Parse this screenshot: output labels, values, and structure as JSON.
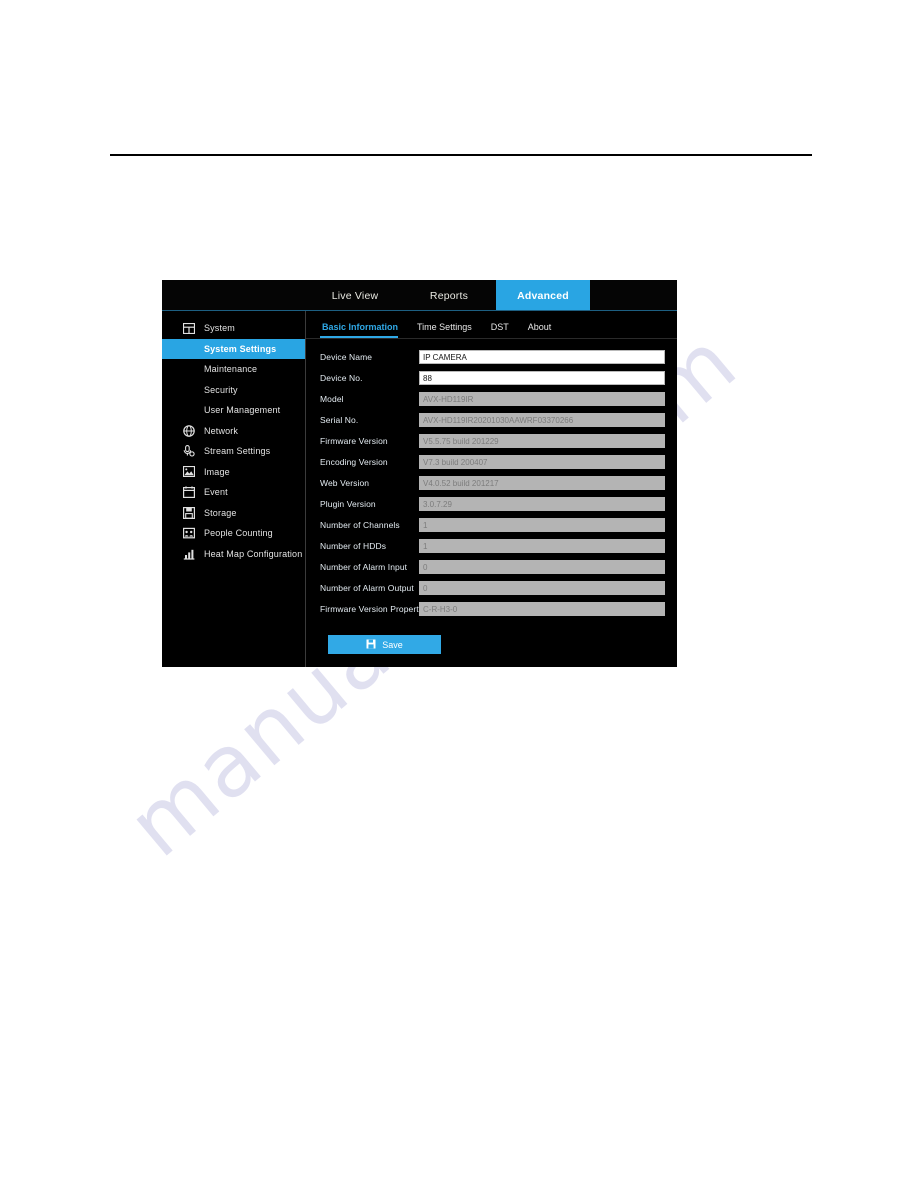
{
  "page": {
    "watermark_text": "manualslive.com",
    "rule": "horizontal-rule"
  },
  "app": {
    "accent_color": "#29a5e3",
    "background_color": "#000000",
    "top_nav": {
      "tabs": [
        {
          "label": "Live View",
          "active": false
        },
        {
          "label": "Reports",
          "active": false
        },
        {
          "label": "Advanced",
          "active": true
        }
      ]
    },
    "sidebar": {
      "items": [
        {
          "label": "System",
          "icon": "system-icon",
          "level": "top",
          "active": false
        },
        {
          "label": "System Settings",
          "icon": "",
          "level": "sub",
          "active": true
        },
        {
          "label": "Maintenance",
          "icon": "",
          "level": "sub",
          "active": false
        },
        {
          "label": "Security",
          "icon": "",
          "level": "sub",
          "active": false
        },
        {
          "label": "User Management",
          "icon": "",
          "level": "sub",
          "active": false
        },
        {
          "label": "Network",
          "icon": "globe-icon",
          "level": "top",
          "active": false
        },
        {
          "label": "Stream Settings",
          "icon": "microphone-icon",
          "level": "top",
          "active": false
        },
        {
          "label": "Image",
          "icon": "picture-icon",
          "level": "top",
          "active": false
        },
        {
          "label": "Event",
          "icon": "calendar-icon",
          "level": "top",
          "active": false
        },
        {
          "label": "Storage",
          "icon": "floppy-disk-icon",
          "level": "top",
          "active": false
        },
        {
          "label": "People Counting",
          "icon": "people-counting-icon",
          "level": "top",
          "active": false
        },
        {
          "label": "Heat Map Configuration",
          "icon": "bar-chart-icon",
          "level": "top",
          "active": false
        }
      ]
    },
    "sub_tabs": [
      {
        "label": "Basic Information",
        "active": true
      },
      {
        "label": "Time Settings",
        "active": false
      },
      {
        "label": "DST",
        "active": false
      },
      {
        "label": "About",
        "active": false
      }
    ],
    "form": {
      "fields": [
        {
          "label": "Device Name",
          "value": "IP CAMERA",
          "readonly": false
        },
        {
          "label": "Device No.",
          "value": "88",
          "readonly": false
        },
        {
          "label": "Model",
          "value": "AVX-HD119IR",
          "readonly": true
        },
        {
          "label": "Serial No.",
          "value": "AVX-HD119IR20201030AAWRF03370266",
          "readonly": true
        },
        {
          "label": "Firmware Version",
          "value": "V5.5.75 build 201229",
          "readonly": true
        },
        {
          "label": "Encoding Version",
          "value": "V7.3 build 200407",
          "readonly": true
        },
        {
          "label": "Web Version",
          "value": "V4.0.52 build 201217",
          "readonly": true
        },
        {
          "label": "Plugin Version",
          "value": "3.0.7.29",
          "readonly": true
        },
        {
          "label": "Number of Channels",
          "value": "1",
          "readonly": true
        },
        {
          "label": "Number of HDDs",
          "value": "1",
          "readonly": true
        },
        {
          "label": "Number of Alarm Input",
          "value": "0",
          "readonly": true
        },
        {
          "label": "Number of Alarm Output",
          "value": "0",
          "readonly": true
        },
        {
          "label": "Firmware Version Property",
          "value": "C-R-H3-0",
          "readonly": true
        }
      ],
      "save_label": "Save",
      "save_icon": "floppy-disk-icon"
    }
  }
}
